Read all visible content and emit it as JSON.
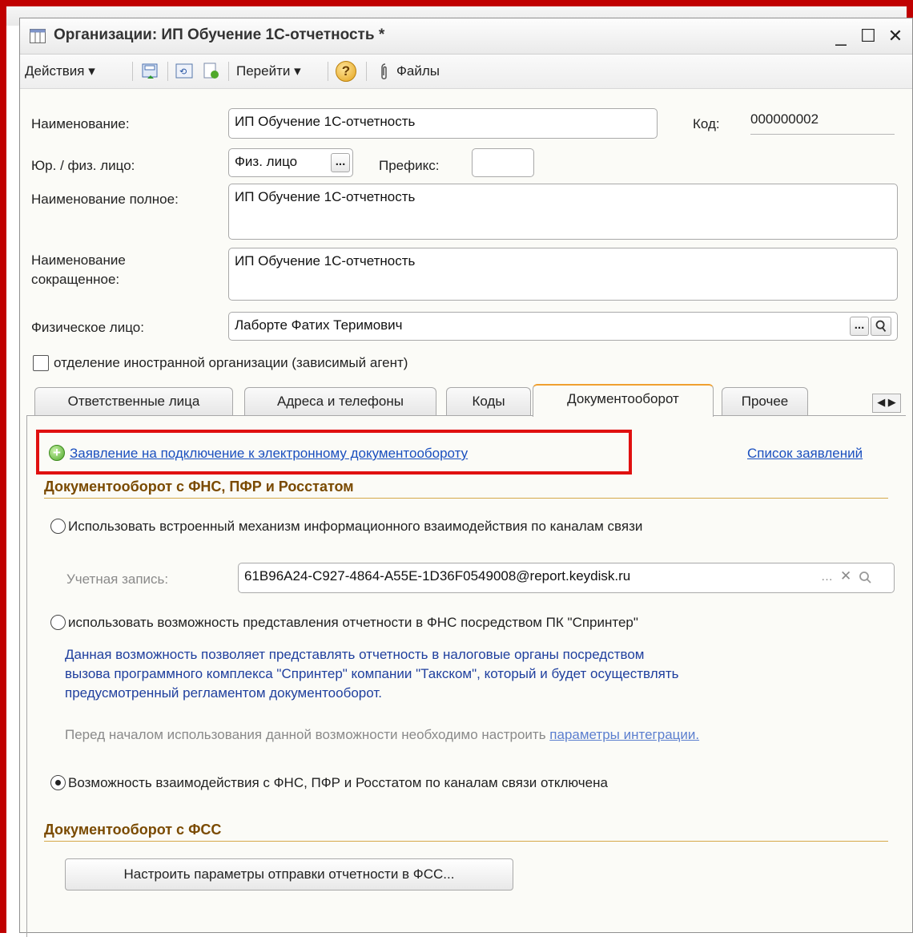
{
  "window": {
    "title": "Организации: ИП Обучение 1С-отчетность *",
    "minimize": "_",
    "maximize": "☐",
    "close": "✕"
  },
  "toolbar": {
    "actions": "Действия ▾",
    "goto": "Перейти ▾",
    "help": "?",
    "files": "Файлы"
  },
  "form": {
    "name_label": "Наименование:",
    "name_value": "ИП Обучение 1С-отчетность",
    "code_label": "Код:",
    "code_value": "000000002",
    "legal_label": "Юр. / физ. лицо:",
    "legal_value": "Физ. лицо",
    "legal_btn": "...",
    "prefix_label": "Префикс:",
    "prefix_value": "",
    "full_name_label": "Наименование полное:",
    "full_name_value": "ИП Обучение 1С-отчетность",
    "short_name_label_1": "Наименование",
    "short_name_label_2": "сокращенное:",
    "short_name_value": "ИП Обучение 1С-отчетность",
    "person_label": "Физическое лицо:",
    "person_value": "Лаборте Фатих Теримович",
    "person_btn": "...",
    "foreign_checkbox_label": "отделение иностранной организации (зависимый агент)"
  },
  "tabs": [
    "Ответственные лица",
    "Адреса и телефоны",
    "Коды",
    "Документооборот",
    "Прочее"
  ],
  "tab_arrows": "◀ ▶",
  "edo": {
    "application_link": "Заявление на подключение к электронному документообороту",
    "list_link": "Список заявлений",
    "section1_title": "Документооборот с ФНС, ПФР и Росстатом",
    "radio1_label": "Использовать встроенный механизм информационного взаимодействия по каналам связи",
    "account_label": "Учетная запись:",
    "account_value": "61B96A24-C927-4864-A55E-1D36F0549008@report.keydisk.ru",
    "radio2_label": "использовать возможность представления отчетности в ФНС посредством ПК \"Спринтер\"",
    "info_line1": "Данная возможность позволяет представлять отчетность в налоговые органы посредством",
    "info_line2": "вызова программного комплекса \"Спринтер\" компании \"Такском\", который и будет осуществлять",
    "info_line3": "предусмотренный регламентом документооборот.",
    "hint_text": "Перед началом использования данной возможности необходимо настроить ",
    "hint_link": "параметры интеграции.",
    "radio3_label": "Возможность взаимодействия с ФНС, ПФР и Росстатом по каналам связи отключена",
    "section2_title": "Документооборот с ФСС",
    "fss_button": "Настроить параметры отправки отчетности в ФСС..."
  }
}
